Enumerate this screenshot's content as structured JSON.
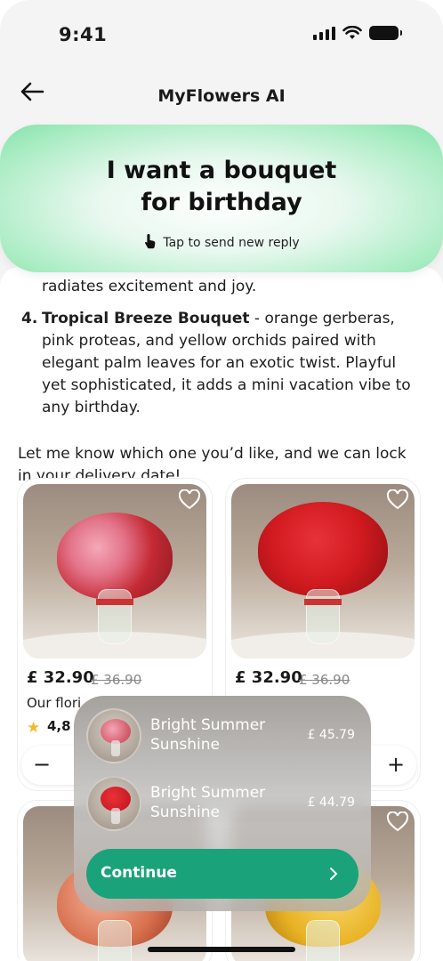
{
  "status_bar": {
    "time": "9:41"
  },
  "nav": {
    "title": "MyFlowers AI"
  },
  "prompt": {
    "title_line1": "I want a bouquet",
    "title_line2": "for birthday",
    "hint": "Tap to send new reply"
  },
  "chat": {
    "continued_text": "radiates excitement and joy.",
    "item4_number": "4.",
    "item4_title": "Tropical Breeze Bouquet",
    "item4_body": " - orange gerberas, pink proteas, and yellow orchids paired with elegant palm leaves for an exotic twist. Playful yet sophisticated, it adds a mini vacation vibe to any birthday.",
    "closing": "Let me know which one you’d like, and we can lock in your delivery date!"
  },
  "products": [
    {
      "price": "£ 32.90",
      "old_price": "£ 36.90",
      "desc": "Our flori",
      "rating": "4,8",
      "bouquet_color": "#c42a34"
    },
    {
      "price": "£ 32.90",
      "old_price": "£ 36.90",
      "bouquet_color": "#d01a1f"
    }
  ],
  "selection": {
    "items": [
      {
        "name": "Bright Summer Sunshine",
        "price": "£ 45.79",
        "color": "#c43a48"
      },
      {
        "name": "Bright Summer Sunshine",
        "price": "£ 44.79",
        "color": "#c0121c"
      }
    ],
    "continue_label": "Continue"
  },
  "colors": {
    "accent": "#1aa37a",
    "prompt_gradient": "#84e2ab"
  }
}
